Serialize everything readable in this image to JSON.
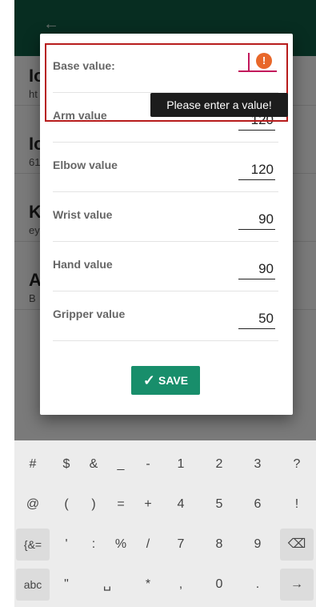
{
  "background": {
    "items": [
      {
        "title": "Io",
        "sub": "ht"
      },
      {
        "title": "Io",
        "sub": "61"
      },
      {
        "title": "K",
        "sub": "ey"
      },
      {
        "title": "A",
        "sub": "B"
      }
    ]
  },
  "dialog": {
    "rows": [
      {
        "label": "Base value:",
        "value": ""
      },
      {
        "label": "Arm value",
        "value": "120"
      },
      {
        "label": "Elbow value",
        "value": "120"
      },
      {
        "label": "Wrist value",
        "value": "90"
      },
      {
        "label": "Hand value",
        "value": "90"
      },
      {
        "label": "Gripper value",
        "value": "50"
      }
    ],
    "error_tooltip": "Please enter a value!",
    "error_icon": "!",
    "save_label": "SAVE"
  },
  "keyboard": {
    "rows": [
      [
        "#",
        "$",
        "&",
        "_",
        "-",
        "1",
        "2",
        "3",
        "?"
      ],
      [
        "@",
        "(",
        ")",
        "=",
        "+",
        "4",
        "5",
        "6",
        "!"
      ],
      [
        "{&=",
        "'",
        ":",
        "%",
        "/",
        "7",
        "8",
        "9",
        "⌫"
      ],
      [
        "abc",
        "\"",
        "␣",
        "*",
        ",",
        "0",
        ".",
        "→"
      ]
    ]
  },
  "colors": {
    "appbar": "#0e5a43",
    "accent": "#188e6b",
    "error": "#e8672a",
    "highlight": "#b71c1c"
  }
}
